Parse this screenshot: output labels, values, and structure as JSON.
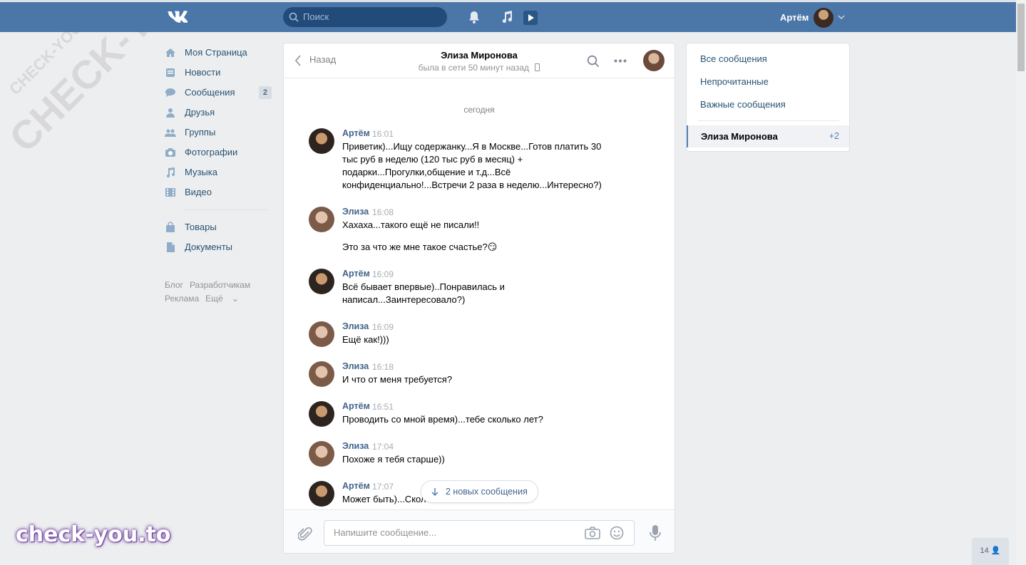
{
  "header": {
    "search_placeholder": "Поиск",
    "user_name": "Артём"
  },
  "left_menu": {
    "items": [
      {
        "label": "Моя Страница",
        "icon": "home-icon"
      },
      {
        "label": "Новости",
        "icon": "news-icon"
      },
      {
        "label": "Сообщения",
        "icon": "messages-icon",
        "count": "2"
      },
      {
        "label": "Друзья",
        "icon": "friends-icon"
      },
      {
        "label": "Группы",
        "icon": "groups-icon"
      },
      {
        "label": "Фотографии",
        "icon": "camera-icon"
      },
      {
        "label": "Музыка",
        "icon": "music-icon"
      },
      {
        "label": "Видео",
        "icon": "video-icon"
      }
    ],
    "items2": [
      {
        "label": "Товары",
        "icon": "bag-icon"
      },
      {
        "label": "Документы",
        "icon": "document-icon"
      }
    ],
    "footer": [
      "Блог",
      "Разработчикам",
      "Реклама",
      "Ещё"
    ]
  },
  "dialog": {
    "back_label": "Назад",
    "title": "Элиза Миронова",
    "status": "была в сети 50 минут назад",
    "day_separator": "сегодня",
    "messages": [
      {
        "author": "Артём",
        "time": "16:01",
        "text": "Приветик)...Ищу содержанку...Я в Москве...Готов платить 30 тыс руб в неделю (120 тыс руб в месяц) + подарки...Прогулки,общение и т.д...Всё конфиденциально!...Встречи 2 раза в неделю...Интересно?)"
      },
      {
        "author": "Элиза",
        "time": "16:08",
        "text": "Хахаха...такого ещё не писали!!",
        "text2": "Это за что же мне такое счастье?😏"
      },
      {
        "author": "Артём",
        "time": "16:09",
        "text": "Всё бывает впервые)..Понравилась и написал...Заинтересовало?)"
      },
      {
        "author": "Элиза",
        "time": "16:09",
        "text": "Ещё как!)))"
      },
      {
        "author": "Элиза",
        "time": "16:18",
        "text": "И что от меня требуется?"
      },
      {
        "author": "Артём",
        "time": "16:51",
        "text": "Проводить со мной время)...тебе сколько лет?"
      },
      {
        "author": "Элиза",
        "time": "17:04",
        "text": "Похоже я тебя старше))"
      },
      {
        "author": "Артём",
        "time": "17:07",
        "text": "Может быть)...Скол"
      }
    ],
    "new_messages_label": "2 новых сообщения",
    "input_placeholder": "Напишите сообщение..."
  },
  "right_panel": {
    "items": [
      "Все сообщения",
      "Непрочитанные",
      "Важные сообщения"
    ],
    "active_chat": {
      "name": "Элиза Миронова",
      "count": "+2"
    }
  },
  "online_count": "14",
  "watermark": "CHECK-YOU.ME",
  "brand": "check-you.to",
  "colors": {
    "header": "#4a76a8",
    "link": "#285473",
    "author": "#42648b",
    "accent": "#5181b8"
  }
}
